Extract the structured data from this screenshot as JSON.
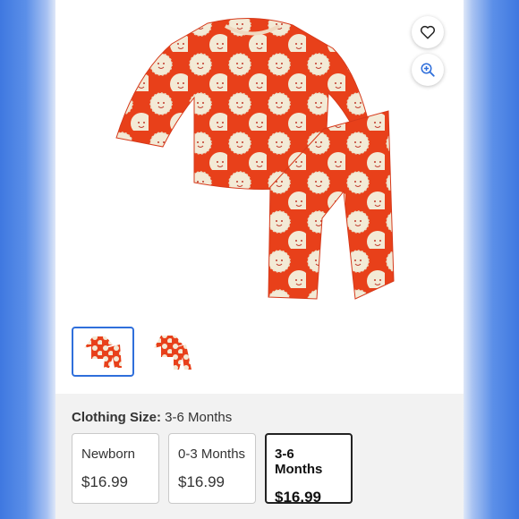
{
  "product": {
    "image_alt": "Orange baby pajama set with lion print",
    "icons": {
      "favorite": "heart-outline-icon",
      "zoom": "zoom-in-icon"
    },
    "colors": {
      "accent": "#2f6fdb",
      "fabric": "#e8401a",
      "print": "#f3ead6"
    }
  },
  "thumbnails": [
    {
      "name": "front view",
      "selected": true
    },
    {
      "name": "back view",
      "selected": false
    }
  ],
  "size": {
    "label": "Clothing Size:",
    "value": "3-6 Months",
    "options": [
      {
        "name": "Newborn",
        "price": "$16.99",
        "selected": false
      },
      {
        "name": "0-3 Months",
        "price": "$16.99",
        "selected": false
      },
      {
        "name": "3-6 Months",
        "price": "$16.99",
        "selected": true
      }
    ]
  }
}
